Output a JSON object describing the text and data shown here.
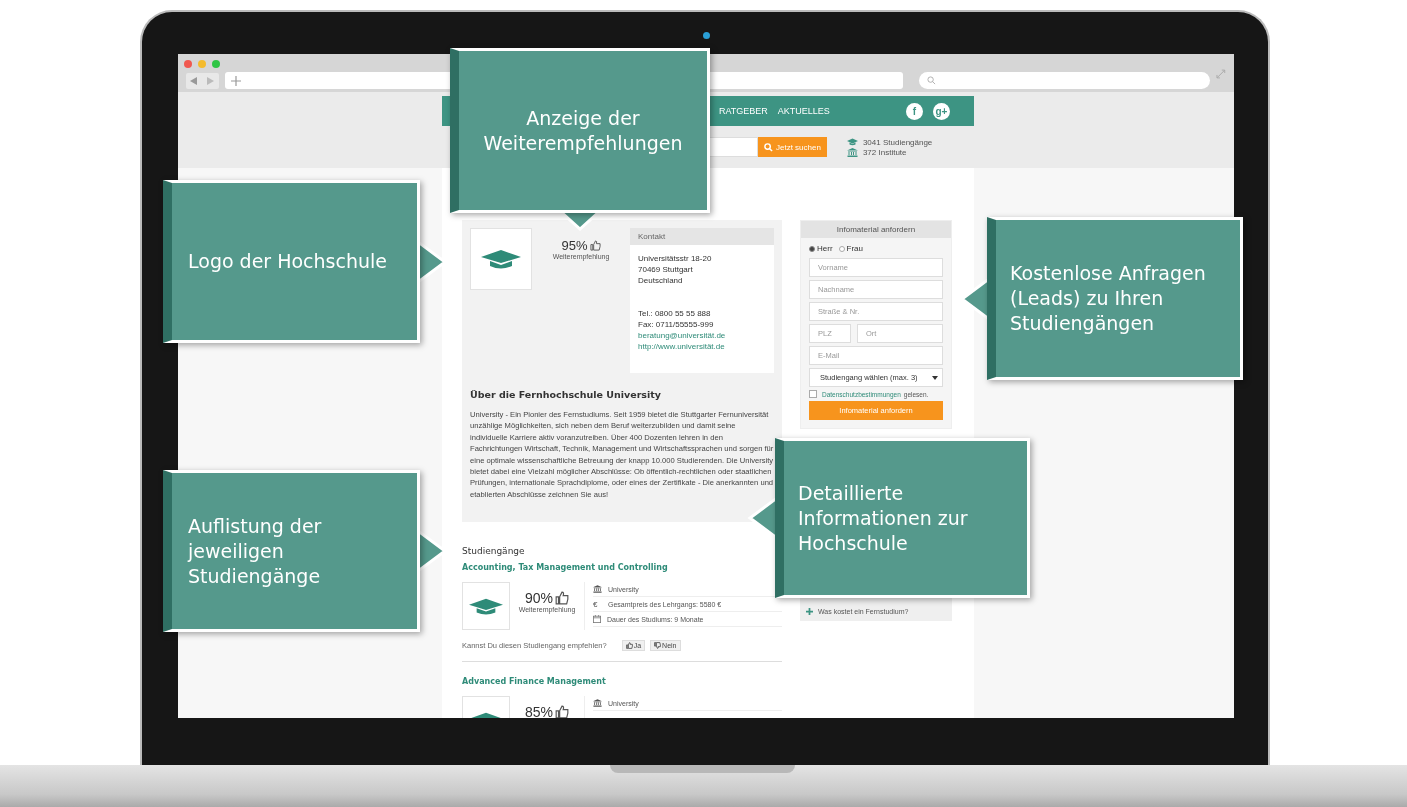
{
  "nav": {
    "items": [
      {
        "label": "RATGEBER"
      },
      {
        "label": "AKTUELLES"
      }
    ],
    "social": [
      {
        "label": "f"
      },
      {
        "label": "g+"
      }
    ]
  },
  "search": {
    "button": "Jetzt suchen",
    "stats": [
      {
        "kind": "courses",
        "text": "3041 Studiengänge"
      },
      {
        "kind": "institutes",
        "text": "372 Institute"
      }
    ]
  },
  "profile": {
    "recommendation": "95%",
    "recommendation_label": "Weiterempfehlung",
    "contact": {
      "title": "Kontakt",
      "address": [
        "Universitätsstr 18-20",
        "70469 Stuttgart",
        "Deutschland"
      ],
      "phone": "Tel.: 0800 55 55 888",
      "fax": "Fax: 0711/55555-999",
      "email": "beratung@universität.de",
      "web": "http://www.universität.de"
    }
  },
  "about": {
    "title": "Über die Fernhochschule University",
    "text": "University - Ein Pionier des Fernstudiums. Seit 1959 bietet die Stuttgarter Fernuniversität unzählige Möglichkeiten, sich neben dem Beruf weiterzubilden und damit seine individuelle Karriere aktiv voranzutreiben. Über 400 Dozenten lehren in den Fachrichtungen Wirtschaft, Technik, Management und Wirtschaftssprachen und sorgen für eine optimale wissenschaftliche Betreuung der knapp 10.000 Studierenden. Die University bietet dabei eine Vielzahl möglicher Abschlüsse: Ob öffentlich-rechtlichen oder staatlichen Prüfungen, internationale Sprachdiplome, oder eines der Zertifikate - Die anerkannten und etablierten Abschlüsse zeichnen Sie aus!"
  },
  "courses": {
    "title": "Studiengänge",
    "items": [
      {
        "name": "Accounting, Tax Management und Controlling",
        "recommendation": "90%",
        "recommendation_label": "Weiterempfehlung",
        "institute": "University",
        "price_symbol": "€",
        "price": "Gesamtpreis des Lehrgangs: 5580 €",
        "duration": "Dauer des Studiums: 9 Monate",
        "question": "Kannst Du diesen Studiengang empfehlen?",
        "yes": "Ja",
        "no": "Nein"
      },
      {
        "name": "Advanced Finance Management",
        "recommendation": "85%",
        "institute": "University"
      }
    ]
  },
  "form": {
    "title": "Infomaterial anfordern",
    "salutations": [
      {
        "label": "Herr",
        "selected": true
      },
      {
        "label": "Frau",
        "selected": false
      }
    ],
    "field_rows": [
      {
        "fields": [
          {
            "placeholder": "Vorname"
          }
        ]
      },
      {
        "fields": [
          {
            "placeholder": "Nachname"
          }
        ]
      },
      {
        "fields": [
          {
            "placeholder": "Straße & Nr."
          }
        ]
      },
      {
        "fields": [
          {
            "placeholder": "PLZ"
          },
          {
            "placeholder": "Ort"
          }
        ]
      },
      {
        "fields": [
          {
            "placeholder": "E-Mail"
          }
        ]
      }
    ],
    "select": "Studiengang wählen (max. 3)",
    "privacy": {
      "checked": false,
      "link": "Datenschutzbestimmungen",
      "text": "gelesen."
    },
    "submit": "Infomaterial anfordern"
  },
  "faq": {
    "items": [
      {
        "question": "Was kostet ein Fernstudium?"
      }
    ]
  },
  "callouts": [
    {
      "text": "Anzeige der Weiterempfehlungen",
      "kind": "down"
    },
    {
      "text": "Logo der Hochschule",
      "kind": "right"
    },
    {
      "text": "Kostenlose Anfragen (Leads) zu Ihren Studiengängen",
      "kind": "left"
    },
    {
      "text": "Detaillierte Informationen zur Hochschule",
      "kind": "left"
    },
    {
      "text": "Auflistung der jeweiligen Studiengänge",
      "kind": "right"
    }
  ]
}
